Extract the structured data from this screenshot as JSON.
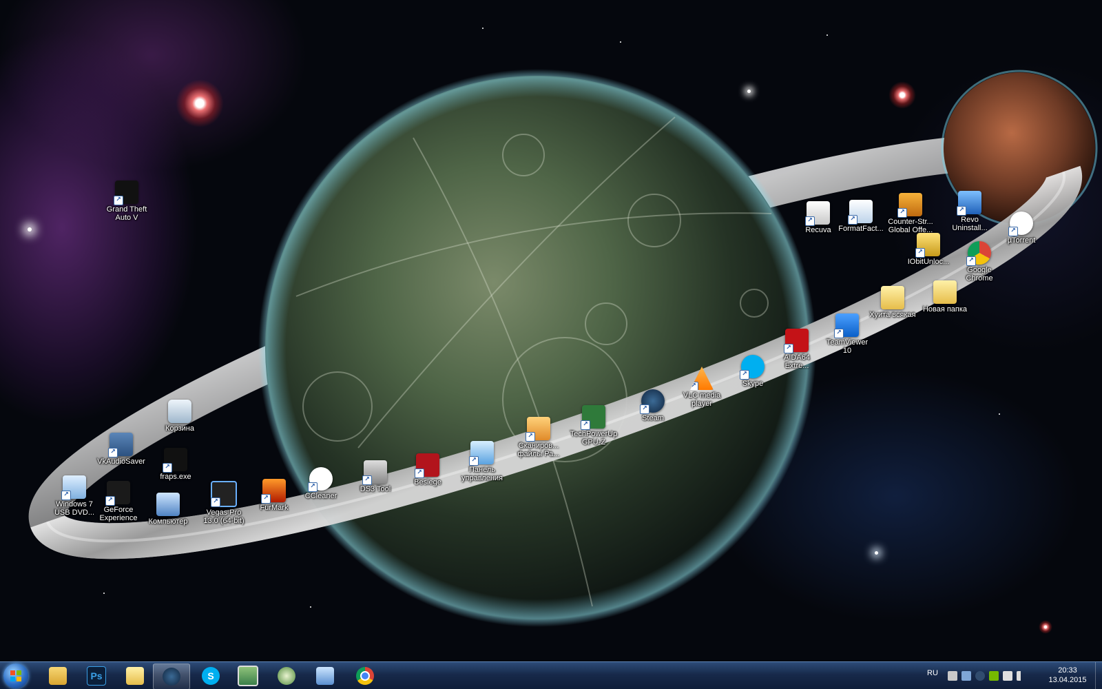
{
  "desktop": {
    "icons": [
      {
        "label": "Grand Theft\nAuto V",
        "icon": "gta-v-icon"
      },
      {
        "label": "Корзина",
        "icon": "recycle-bin-icon"
      },
      {
        "label": "VkAudioSaver",
        "icon": "vkaudiosaver-icon"
      },
      {
        "label": "fraps.exe",
        "icon": "fraps-icon"
      },
      {
        "label": "Windows 7\nUSB DVD...",
        "icon": "win7-usb-dvd-icon"
      },
      {
        "label": "GeForce\nExperience",
        "icon": "geforce-icon"
      },
      {
        "label": "Компьютер",
        "icon": "computer-icon"
      },
      {
        "label": "Vegas Pro\n13.0 (64-bit)",
        "icon": "vegas-pro-icon"
      },
      {
        "label": "FurMark",
        "icon": "furmark-icon"
      },
      {
        "label": "CCleaner",
        "icon": "ccleaner-icon"
      },
      {
        "label": "DS3 Tool",
        "icon": "ds3-tool-icon"
      },
      {
        "label": "Besiege",
        "icon": "besiege-icon"
      },
      {
        "label": "Панель\nуправления",
        "icon": "control-panel-icon"
      },
      {
        "label": "Сканиров...\nфайлы Ра...",
        "icon": "scan-files-icon"
      },
      {
        "label": "TechPowerUp\nGPU-Z",
        "icon": "gpu-z-icon"
      },
      {
        "label": "Steam",
        "icon": "steam-icon"
      },
      {
        "label": "VLC media\nplayer",
        "icon": "vlc-icon"
      },
      {
        "label": "Skype",
        "icon": "skype-icon"
      },
      {
        "label": "AIDA64\nExtre...",
        "icon": "aida64-icon"
      },
      {
        "label": "TeamViewer\n10",
        "icon": "teamviewer-icon"
      },
      {
        "label": "Хуита всякая",
        "icon": "folder-icon"
      },
      {
        "label": "Новая папка",
        "icon": "folder-icon"
      },
      {
        "label": "Recuva",
        "icon": "recuva-icon"
      },
      {
        "label": "FormatFact...",
        "icon": "formatfactory-icon"
      },
      {
        "label": "Counter-Str...\nGlobal Offe...",
        "icon": "csgo-icon"
      },
      {
        "label": "Revo\nUninstall...",
        "icon": "revo-uninstaller-icon"
      },
      {
        "label": "µTorrent",
        "icon": "utorrent-icon"
      },
      {
        "label": "IObitUnloc...",
        "icon": "iobit-unlocker-icon"
      },
      {
        "label": "Google\nChrome",
        "icon": "chrome-icon"
      }
    ]
  },
  "taskbar": {
    "start": "start-button",
    "pinned": [
      {
        "name": "explorer",
        "icon": "folder-library-icon",
        "glyph": ""
      },
      {
        "name": "photoshop",
        "icon": "photoshop-icon",
        "glyph": "Ps"
      },
      {
        "name": "folder",
        "icon": "folder-icon",
        "glyph": ""
      },
      {
        "name": "steam",
        "icon": "steam-icon",
        "glyph": "",
        "active": true
      },
      {
        "name": "skype",
        "icon": "skype-icon",
        "glyph": "S"
      },
      {
        "name": "photo-viewer",
        "icon": "photo-viewer-icon",
        "glyph": ""
      },
      {
        "name": "tool",
        "icon": "tool-icon",
        "glyph": ""
      },
      {
        "name": "remote-desktop",
        "icon": "monitor-icon",
        "glyph": ""
      },
      {
        "name": "chrome",
        "icon": "chrome-icon",
        "glyph": ""
      }
    ],
    "tray": {
      "language": "RU",
      "time": "20:33",
      "date": "13.04.2015"
    }
  },
  "colors": {
    "taskbar": "#17294a",
    "space": "#05070d"
  }
}
